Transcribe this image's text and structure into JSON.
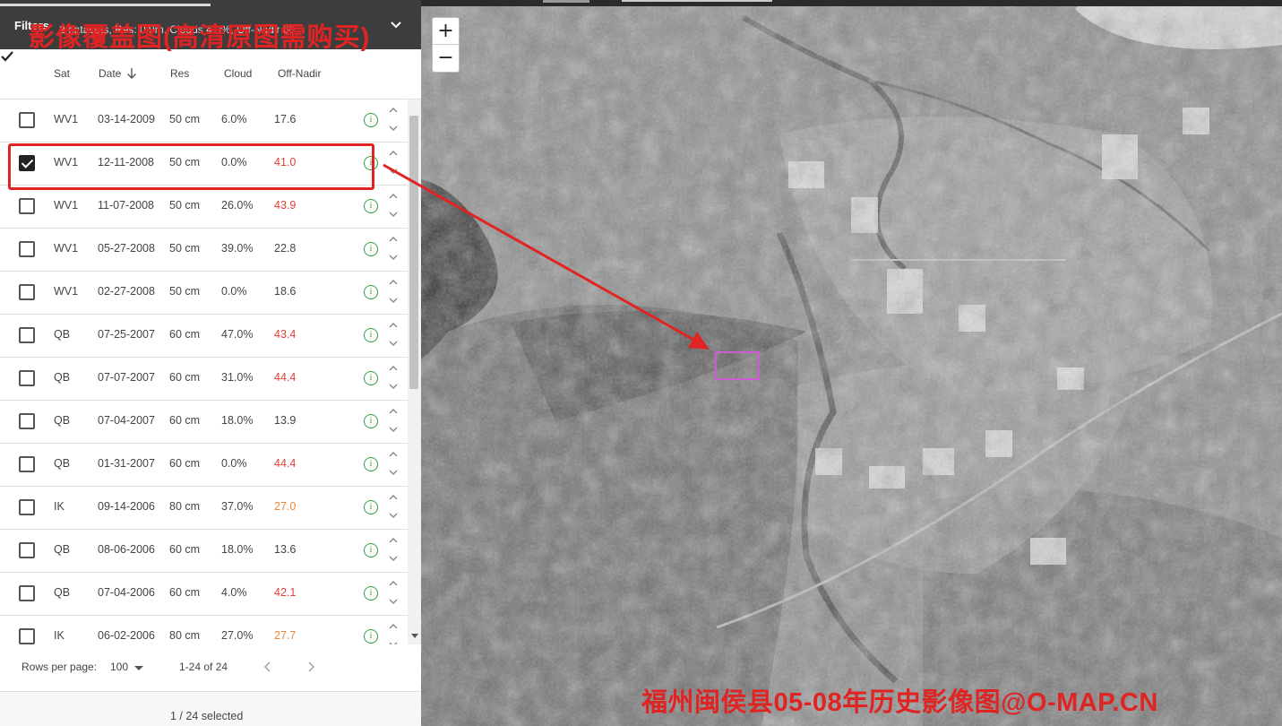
{
  "filters": {
    "title": "Filters",
    "summary": "2 datasets, Res: 0.9m, Clouds 4 0%, Off-Nadir 60",
    "watermark": "影像覆盖图(高清原图需购买)"
  },
  "table": {
    "columns": {
      "sat": "Sat",
      "date": "Date",
      "res": "Res",
      "cloud": "Cloud",
      "nadir": "Off-Nadir"
    },
    "rows": [
      {
        "sat": "WV1",
        "date": "03-14-2009",
        "res": "50 cm",
        "cloud": "6.0%",
        "nadir": "17.6",
        "checked": false,
        "nadir_color": "#444444"
      },
      {
        "sat": "WV1",
        "date": "12-11-2008",
        "res": "50 cm",
        "cloud": "0.0%",
        "nadir": "41.0",
        "checked": true,
        "nadir_color": "#e0403a"
      },
      {
        "sat": "WV1",
        "date": "11-07-2008",
        "res": "50 cm",
        "cloud": "26.0%",
        "nadir": "43.9",
        "checked": false,
        "nadir_color": "#e0403a"
      },
      {
        "sat": "WV1",
        "date": "05-27-2008",
        "res": "50 cm",
        "cloud": "39.0%",
        "nadir": "22.8",
        "checked": false,
        "nadir_color": "#444444"
      },
      {
        "sat": "WV1",
        "date": "02-27-2008",
        "res": "50 cm",
        "cloud": "0.0%",
        "nadir": "18.6",
        "checked": false,
        "nadir_color": "#444444"
      },
      {
        "sat": "QB",
        "date": "07-25-2007",
        "res": "60 cm",
        "cloud": "47.0%",
        "nadir": "43.4",
        "checked": false,
        "nadir_color": "#e0403a"
      },
      {
        "sat": "QB",
        "date": "07-07-2007",
        "res": "60 cm",
        "cloud": "31.0%",
        "nadir": "44.4",
        "checked": false,
        "nadir_color": "#e0403a"
      },
      {
        "sat": "QB",
        "date": "07-04-2007",
        "res": "60 cm",
        "cloud": "18.0%",
        "nadir": "13.9",
        "checked": false,
        "nadir_color": "#444444"
      },
      {
        "sat": "QB",
        "date": "01-31-2007",
        "res": "60 cm",
        "cloud": "0.0%",
        "nadir": "44.4",
        "checked": false,
        "nadir_color": "#e0403a"
      },
      {
        "sat": "IK",
        "date": "09-14-2006",
        "res": "80 cm",
        "cloud": "37.0%",
        "nadir": "27.0",
        "checked": false,
        "nadir_color": "#e8863a"
      },
      {
        "sat": "QB",
        "date": "08-06-2006",
        "res": "60 cm",
        "cloud": "18.0%",
        "nadir": "13.6",
        "checked": false,
        "nadir_color": "#444444"
      },
      {
        "sat": "QB",
        "date": "07-04-2006",
        "res": "60 cm",
        "cloud": "4.0%",
        "nadir": "42.1",
        "checked": false,
        "nadir_color": "#e0403a"
      },
      {
        "sat": "IK",
        "date": "06-02-2006",
        "res": "80 cm",
        "cloud": "27.0%",
        "nadir": "27.7",
        "checked": false,
        "nadir_color": "#e8863a"
      }
    ]
  },
  "pager": {
    "rows_per_page_label": "Rows per page:",
    "rows_per_page": "100",
    "range": "1-24 of 24"
  },
  "footer": {
    "selected": "1 / 24 selected"
  },
  "map": {
    "zoom_in": "+",
    "zoom_out": "−",
    "watermark": "福州闽侯县05-08年历史影像图@O-MAP.CN"
  }
}
